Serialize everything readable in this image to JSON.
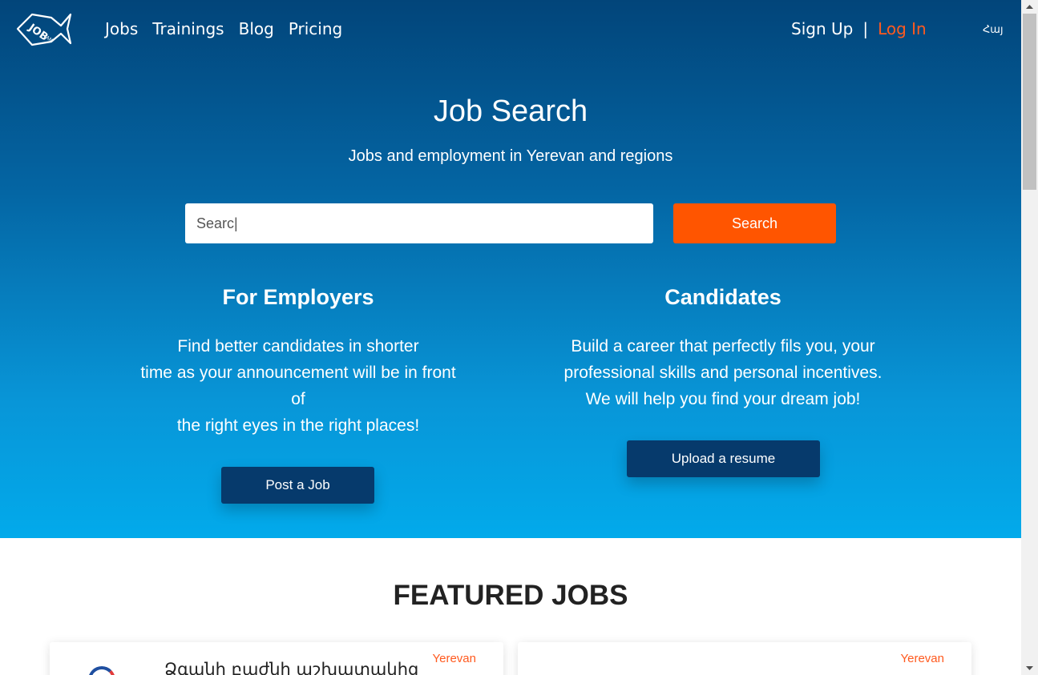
{
  "nav": {
    "items": [
      {
        "label": "Jobs"
      },
      {
        "label": "Trainings"
      },
      {
        "label": "Blog"
      },
      {
        "label": "Pricing"
      }
    ],
    "signup": "Sign Up",
    "separator": "|",
    "login": "Log In",
    "language": "Հայ",
    "logo_icon": "fish-logo-icon"
  },
  "hero": {
    "title": "Job Search",
    "subtitle": "Jobs and employment in Yerevan and regions",
    "search": {
      "value": "Searc|",
      "button": "Search"
    }
  },
  "employers": {
    "heading": "For Employers",
    "text": "Find better candidates in shorter\ntime as your announcement will be in front\nof\nthe right eyes in the right places!",
    "button": "Post a Job"
  },
  "candidates": {
    "heading": "Candidates",
    "text": "Build a career that perfectly fils you, your\nprofessional skills and personal incentives.\nWe will help you find your dream job!",
    "button": "Upload a resume"
  },
  "featured": {
    "title": "FEATURED JOBS",
    "cards": [
      {
        "location": "Yerevan",
        "title": "Ձգանի բաժնի աշխատակից"
      },
      {
        "location": "Yerevan",
        "title": ""
      }
    ]
  },
  "colors": {
    "accent": "#ff5500",
    "dark_button": "#063a6c",
    "hero_top": "#02457a",
    "hero_bottom": "#02aaeb"
  }
}
